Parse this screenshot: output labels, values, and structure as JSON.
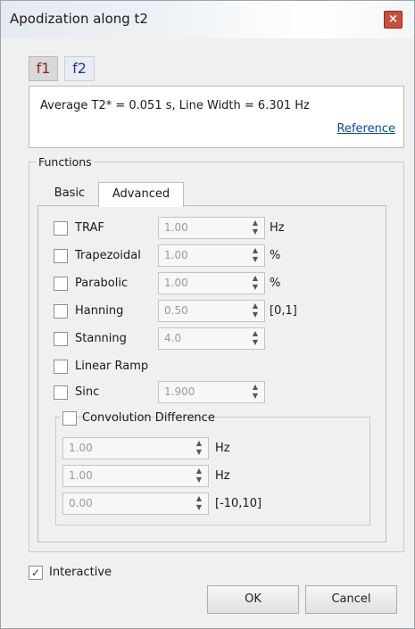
{
  "window": {
    "title": "Apodization along t2",
    "close_glyph": "×"
  },
  "dim_tabs": [
    {
      "label": "f1"
    },
    {
      "label": "f2"
    }
  ],
  "info": {
    "text": "Average T2* = 0.051 s, Line Width = 6.301 Hz",
    "link": "Reference"
  },
  "functions": {
    "group_label": "Functions",
    "tabs": [
      {
        "label": "Basic"
      },
      {
        "label": "Advanced"
      }
    ]
  },
  "rows": [
    {
      "label": "TRAF",
      "value": "1.00",
      "unit": "Hz"
    },
    {
      "label": "Trapezoidal",
      "value": "1.00",
      "unit": "%"
    },
    {
      "label": "Parabolic",
      "value": "1.00",
      "unit": "%"
    },
    {
      "label": "Hanning",
      "value": "0.50",
      "unit": "[0,1]"
    },
    {
      "label": "Stanning",
      "value": "4.0",
      "unit": ""
    },
    {
      "label": "Linear Ramp"
    },
    {
      "label": "Sinc",
      "value": "1.900"
    }
  ],
  "convolution": {
    "label": "Convolution Difference",
    "fields": [
      {
        "value": "1.00",
        "unit": "Hz"
      },
      {
        "value": "1.00",
        "unit": "Hz"
      },
      {
        "value": "0.00",
        "unit": "[-10,10]"
      }
    ]
  },
  "interactive": {
    "label": "Interactive",
    "checked": true,
    "check_glyph": "✓"
  },
  "buttons": {
    "ok": "OK",
    "cancel": "Cancel"
  },
  "arrows": {
    "up": "▲",
    "down": "▼"
  }
}
